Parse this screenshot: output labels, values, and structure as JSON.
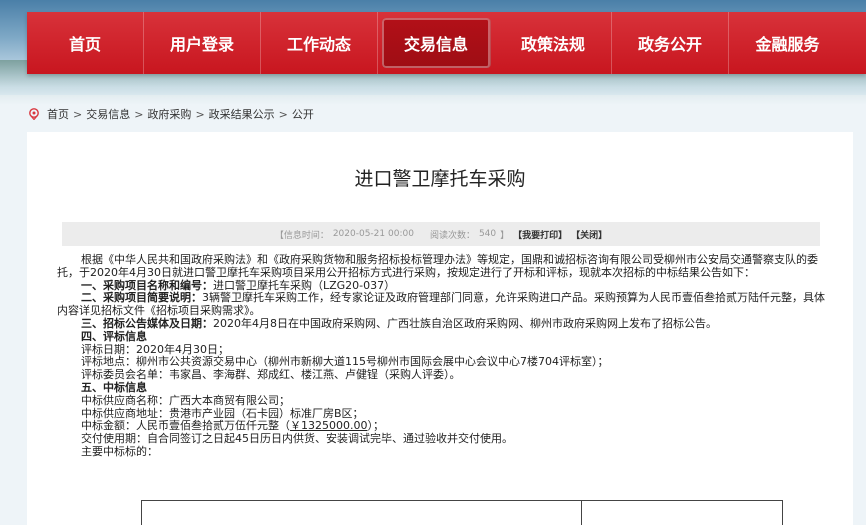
{
  "nav": {
    "items": [
      {
        "label": "首页",
        "active": false
      },
      {
        "label": "用户登录",
        "active": false
      },
      {
        "label": "工作动态",
        "active": false
      },
      {
        "label": "交易信息",
        "active": true
      },
      {
        "label": "政策法规",
        "active": false
      },
      {
        "label": "政务公开",
        "active": false
      },
      {
        "label": "金融服务",
        "active": false
      }
    ]
  },
  "breadcrumb": [
    "首页",
    "交易信息",
    "政府采购",
    "政采结果公示",
    "公开"
  ],
  "breadcrumb_separator": ">",
  "article": {
    "title": "进口警卫摩托车采购",
    "meta": {
      "date_label": "【信息时间：",
      "date": "2020-05-21 00:00",
      "views_label": "阅读次数：",
      "views": "540",
      "close_bracket": "】",
      "print_link": "【我要打印】",
      "close_link": "【关闭】"
    },
    "intro": "根据《中华人民共和国政府采购法》和《政府采购货物和服务招标投标管理办法》等规定，国鼎和诚招标咨询有限公司受柳州市公安局交通警察支队的委托，于2020年4月30日就进口警卫摩托车采购项目采用公开招标方式进行采购，按规定进行了开标和评标，现就本次招标的中标结果公告如下：",
    "s1_label": "一、采购项目名称和编号：",
    "s1_text": "进口警卫摩托车采购（LZG20-037）",
    "s2_label": "二、采购项目简要说明：",
    "s2_text": "3辆警卫摩托车采购工作，经专家论证及政府管理部门同意，允许采购进口产品。采购预算为人民币壹佰叁拾贰万陆仟元整，具体内容详见招标文件《招标项目采购需求》。",
    "s3_label": "三、招标公告媒体及日期：",
    "s3_text": "2020年4月8日在中国政府采购网、广西壮族自治区政府采购网、柳州市政府采购网上发布了招标公告。",
    "s4_label": "四、评标信息",
    "eval_date": "评标日期：2020年4月30日；",
    "eval_place": "评标地点：柳州市公共资源交易中心（柳州市新柳大道115号柳州市国际会展中心会议中心7楼704评标室）；",
    "eval_members": "评标委员会名单：韦家昌、李海群、郑成红、楼江燕、卢健锃（采购人评委）。",
    "s5_label": "五、中标信息",
    "winner_name": "中标供应商名称：广西大本商贸有限公司；",
    "winner_address": "中标供应商地址：贵港市产业园（石卡园）标准厂房B区；",
    "amount_prefix": "中标金额：人民币壹佰叁拾贰万伍仟元整（",
    "amount_value": "￥1325000.00",
    "amount_suffix": "）；",
    "delivery": "交付使用期：自合同签订之日起45日历日内供货、安装调试完毕、通过验收并交付使用。",
    "main_items": "主要中标标的："
  },
  "colors": {
    "nav_red": "#c8161f",
    "nav_active": "#9e0d14",
    "location_icon": "#d9363e"
  },
  "icons": {
    "breadcrumb": "location-pin-icon"
  }
}
